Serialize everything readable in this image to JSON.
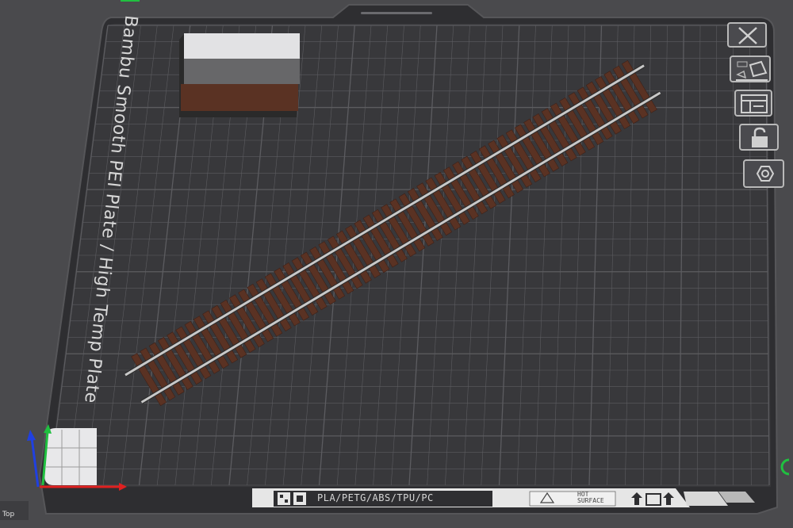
{
  "plate": {
    "name": "Bambu Smooth PEI Plate / High Temp Plate",
    "filaments": "PLA/PETG/ABS/TPU/PC",
    "warning_line1": "HOT",
    "warning_line2": "SURFACE"
  },
  "toolbar": {
    "buttons": [
      {
        "name": "close-icon"
      },
      {
        "name": "auto-orient-icon"
      },
      {
        "name": "arrange-icon"
      },
      {
        "name": "lock-icon"
      },
      {
        "name": "settings-icon"
      }
    ]
  },
  "view": {
    "label": "Top"
  },
  "colors": {
    "plate": "#38383b",
    "grid": "#5c5c60",
    "rail": "#c8c8c8",
    "tie": "#5a3223",
    "axis_x": "#e02020",
    "axis_y": "#20c040",
    "axis_z": "#2040e0"
  }
}
